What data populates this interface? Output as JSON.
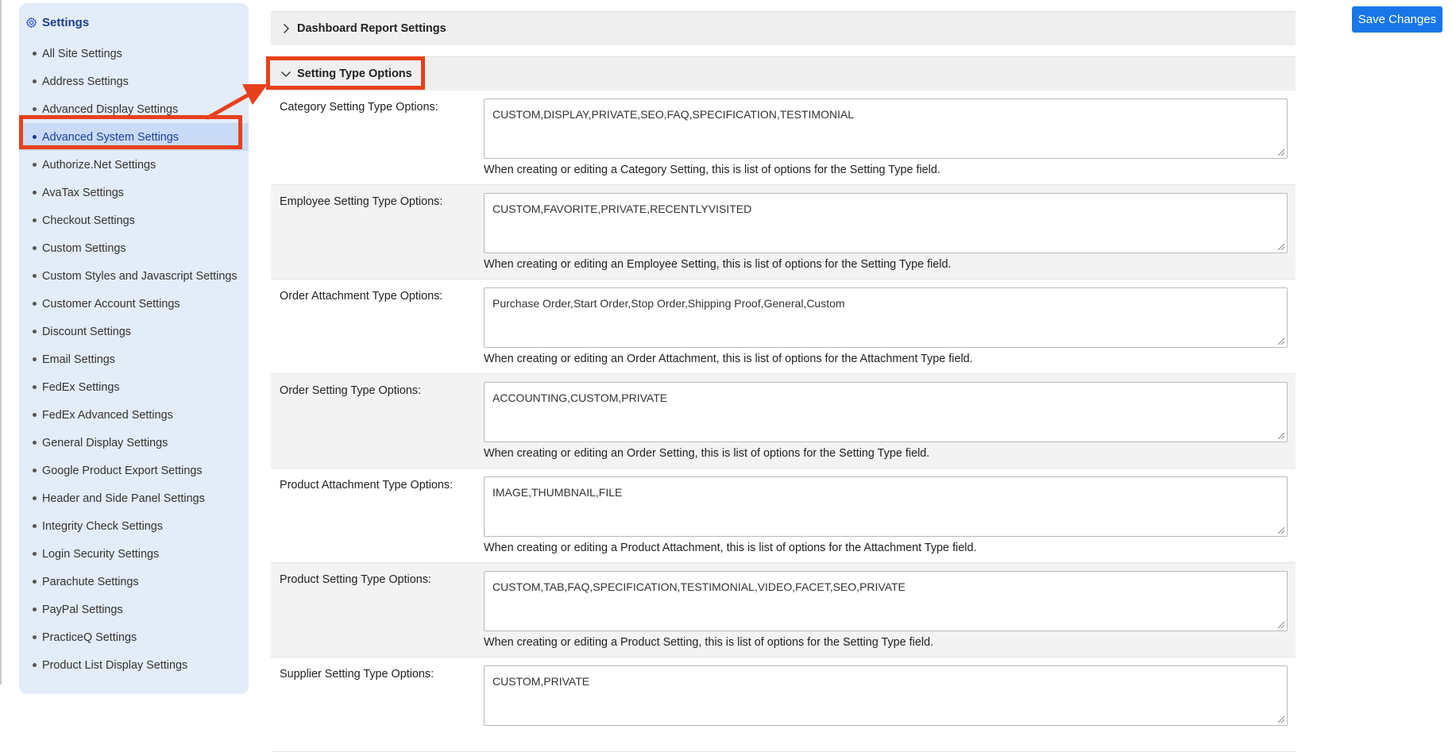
{
  "sidebar": {
    "title": "Settings",
    "items": [
      {
        "label": "All Site Settings"
      },
      {
        "label": "Address Settings"
      },
      {
        "label": "Advanced Display Settings"
      },
      {
        "label": "Advanced System Settings",
        "active": true
      },
      {
        "label": "Authorize.Net Settings"
      },
      {
        "label": "AvaTax Settings"
      },
      {
        "label": "Checkout Settings"
      },
      {
        "label": "Custom Settings"
      },
      {
        "label": "Custom Styles and Javascript Settings"
      },
      {
        "label": "Customer Account Settings"
      },
      {
        "label": "Discount Settings"
      },
      {
        "label": "Email Settings"
      },
      {
        "label": "FedEx Settings"
      },
      {
        "label": "FedEx Advanced Settings"
      },
      {
        "label": "General Display Settings"
      },
      {
        "label": "Google Product Export Settings"
      },
      {
        "label": "Header and Side Panel Settings"
      },
      {
        "label": "Integrity Check Settings"
      },
      {
        "label": "Login Security Settings"
      },
      {
        "label": "Parachute Settings"
      },
      {
        "label": "PayPal Settings"
      },
      {
        "label": "PracticeQ Settings"
      },
      {
        "label": "Product List Display Settings"
      }
    ]
  },
  "sections": {
    "dashboard": {
      "label": "Dashboard Report Settings",
      "expanded": false
    },
    "setting_type": {
      "label": "Setting Type Options",
      "expanded": true
    }
  },
  "fields": [
    {
      "label": "Category Setting Type Options:",
      "value": "CUSTOM,DISPLAY,PRIVATE,SEO,FAQ,SPECIFICATION,TESTIMONIAL",
      "help": "When creating or editing a Category Setting, this is list of options for the Setting Type field."
    },
    {
      "label": "Employee Setting Type Options:",
      "value": "CUSTOM,FAVORITE,PRIVATE,RECENTLYVISITED",
      "help": "When creating or editing an Employee Setting, this is list of options for the Setting Type field."
    },
    {
      "label": "Order Attachment Type Options:",
      "value": "Purchase Order,Start Order,Stop Order,Shipping Proof,General,Custom",
      "help": "When creating or editing an Order Attachment, this is list of options for the Attachment Type field."
    },
    {
      "label": "Order Setting Type Options:",
      "value": "ACCOUNTING,CUSTOM,PRIVATE",
      "help": "When creating or editing an Order Setting, this is list of options for the Setting Type field."
    },
    {
      "label": "Product Attachment Type Options:",
      "value": "IMAGE,THUMBNAIL,FILE",
      "help": "When creating or editing a Product Attachment, this is list of options for the Attachment Type field."
    },
    {
      "label": "Product Setting Type Options:",
      "value": "CUSTOM,TAB,FAQ,SPECIFICATION,TESTIMONIAL,VIDEO,FACET,SEO,PRIVATE",
      "help": "When creating or editing a Product Setting, this is list of options for the Setting Type field."
    },
    {
      "label": "Supplier Setting Type Options:",
      "value": "CUSTOM,PRIVATE",
      "help": ""
    }
  ],
  "toolbar": {
    "save_label": "Save Changes"
  },
  "colors": {
    "accent": "#1976e8",
    "highlight": "#e8401c",
    "sidebar_bg": "#e3ecf9"
  },
  "icons": {
    "sidebar_head": "gear-icon",
    "collapsed": "chevron-right-icon",
    "expanded": "chevron-down-icon"
  }
}
